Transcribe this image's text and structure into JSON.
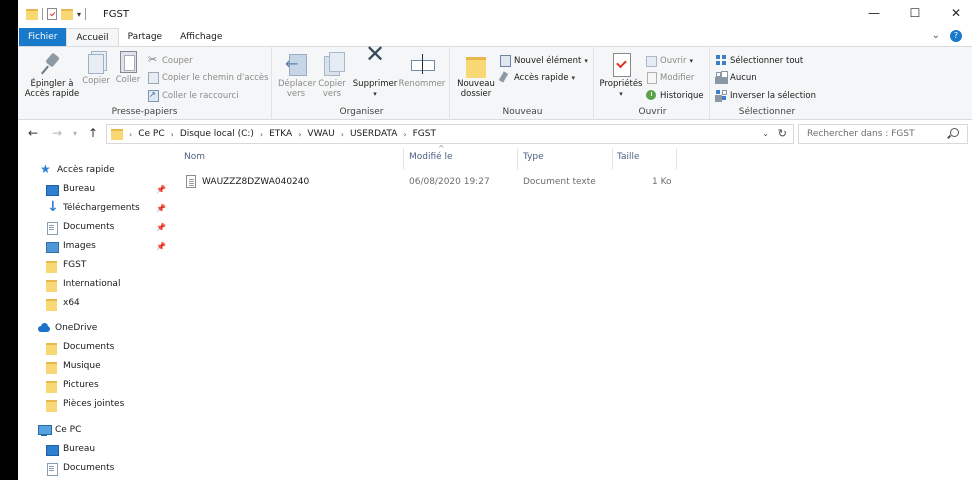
{
  "window": {
    "title": "FGST",
    "minimize": "—",
    "maximize": "☐",
    "close": "✕"
  },
  "ribbon_tabs": [
    {
      "label": "Fichier"
    },
    {
      "label": "Accueil"
    },
    {
      "label": "Partage"
    },
    {
      "label": "Affichage"
    }
  ],
  "ribbon": {
    "presse_papiers": {
      "label": "Presse-papiers",
      "pin": "Épingler à\nAccès rapide",
      "copy": "Copier",
      "paste": "Coller",
      "cut": "Couper",
      "copy_path": "Copier le chemin d'accès",
      "paste_shortcut": "Coller le raccourci"
    },
    "organiser": {
      "label": "Organiser",
      "move_to": "Déplacer\nvers",
      "copy_to": "Copier\nvers",
      "delete": "Supprimer",
      "rename": "Renommer"
    },
    "nouveau": {
      "label": "Nouveau",
      "new_folder": "Nouveau\ndossier",
      "new_item": "Nouvel élément",
      "quick_access": "Accès rapide"
    },
    "ouvrir": {
      "label": "Ouvrir",
      "properties": "Propriétés",
      "open": "Ouvrir",
      "edit": "Modifier",
      "history": "Historique"
    },
    "selectionner": {
      "label": "Sélectionner",
      "select_all": "Sélectionner tout",
      "select_none": "Aucun",
      "invert": "Inverser la sélection"
    }
  },
  "address": {
    "crumbs": [
      "Ce PC",
      "Disque local (C:)",
      "ETKA",
      "VWAU",
      "USERDATA",
      "FGST"
    ],
    "search_placeholder": "Rechercher dans : FGST"
  },
  "nav": {
    "quick_access": "Accès rapide",
    "quick_items": [
      "Bureau",
      "Téléchargements",
      "Documents",
      "Images",
      "FGST",
      "International",
      "x64"
    ],
    "onedrive": "OneDrive",
    "onedrive_items": [
      "Documents",
      "Musique",
      "Pictures",
      "Pièces jointes"
    ],
    "this_pc": "Ce PC",
    "pc_items": [
      "Bureau",
      "Documents"
    ]
  },
  "columns": {
    "name": "Nom",
    "modified": "Modifié le",
    "type": "Type",
    "size": "Taille"
  },
  "files": [
    {
      "name": "WAUZZZ8DZWA040240",
      "modified": "06/08/2020 19:27",
      "type": "Document texte",
      "size": "1 Ko"
    }
  ],
  "icons": {
    "pin": "pin-icon",
    "back": "←",
    "forward": "→",
    "up": "↑",
    "refresh": "↻"
  },
  "colors": {
    "file_tab": "#1979ca",
    "column_header": "#4d6082",
    "folder": "#f8d775"
  }
}
